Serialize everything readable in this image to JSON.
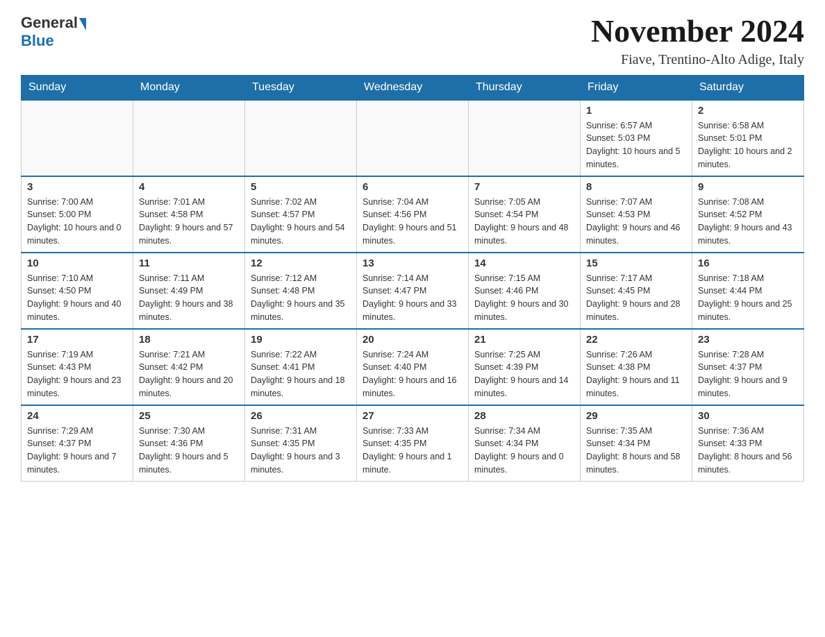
{
  "logo": {
    "general": "General",
    "blue": "Blue"
  },
  "title": "November 2024",
  "location": "Fiave, Trentino-Alto Adige, Italy",
  "days_of_week": [
    "Sunday",
    "Monday",
    "Tuesday",
    "Wednesday",
    "Thursday",
    "Friday",
    "Saturday"
  ],
  "weeks": [
    [
      {
        "day": "",
        "info": ""
      },
      {
        "day": "",
        "info": ""
      },
      {
        "day": "",
        "info": ""
      },
      {
        "day": "",
        "info": ""
      },
      {
        "day": "",
        "info": ""
      },
      {
        "day": "1",
        "info": "Sunrise: 6:57 AM\nSunset: 5:03 PM\nDaylight: 10 hours and 5 minutes."
      },
      {
        "day": "2",
        "info": "Sunrise: 6:58 AM\nSunset: 5:01 PM\nDaylight: 10 hours and 2 minutes."
      }
    ],
    [
      {
        "day": "3",
        "info": "Sunrise: 7:00 AM\nSunset: 5:00 PM\nDaylight: 10 hours and 0 minutes."
      },
      {
        "day": "4",
        "info": "Sunrise: 7:01 AM\nSunset: 4:58 PM\nDaylight: 9 hours and 57 minutes."
      },
      {
        "day": "5",
        "info": "Sunrise: 7:02 AM\nSunset: 4:57 PM\nDaylight: 9 hours and 54 minutes."
      },
      {
        "day": "6",
        "info": "Sunrise: 7:04 AM\nSunset: 4:56 PM\nDaylight: 9 hours and 51 minutes."
      },
      {
        "day": "7",
        "info": "Sunrise: 7:05 AM\nSunset: 4:54 PM\nDaylight: 9 hours and 48 minutes."
      },
      {
        "day": "8",
        "info": "Sunrise: 7:07 AM\nSunset: 4:53 PM\nDaylight: 9 hours and 46 minutes."
      },
      {
        "day": "9",
        "info": "Sunrise: 7:08 AM\nSunset: 4:52 PM\nDaylight: 9 hours and 43 minutes."
      }
    ],
    [
      {
        "day": "10",
        "info": "Sunrise: 7:10 AM\nSunset: 4:50 PM\nDaylight: 9 hours and 40 minutes."
      },
      {
        "day": "11",
        "info": "Sunrise: 7:11 AM\nSunset: 4:49 PM\nDaylight: 9 hours and 38 minutes."
      },
      {
        "day": "12",
        "info": "Sunrise: 7:12 AM\nSunset: 4:48 PM\nDaylight: 9 hours and 35 minutes."
      },
      {
        "day": "13",
        "info": "Sunrise: 7:14 AM\nSunset: 4:47 PM\nDaylight: 9 hours and 33 minutes."
      },
      {
        "day": "14",
        "info": "Sunrise: 7:15 AM\nSunset: 4:46 PM\nDaylight: 9 hours and 30 minutes."
      },
      {
        "day": "15",
        "info": "Sunrise: 7:17 AM\nSunset: 4:45 PM\nDaylight: 9 hours and 28 minutes."
      },
      {
        "day": "16",
        "info": "Sunrise: 7:18 AM\nSunset: 4:44 PM\nDaylight: 9 hours and 25 minutes."
      }
    ],
    [
      {
        "day": "17",
        "info": "Sunrise: 7:19 AM\nSunset: 4:43 PM\nDaylight: 9 hours and 23 minutes."
      },
      {
        "day": "18",
        "info": "Sunrise: 7:21 AM\nSunset: 4:42 PM\nDaylight: 9 hours and 20 minutes."
      },
      {
        "day": "19",
        "info": "Sunrise: 7:22 AM\nSunset: 4:41 PM\nDaylight: 9 hours and 18 minutes."
      },
      {
        "day": "20",
        "info": "Sunrise: 7:24 AM\nSunset: 4:40 PM\nDaylight: 9 hours and 16 minutes."
      },
      {
        "day": "21",
        "info": "Sunrise: 7:25 AM\nSunset: 4:39 PM\nDaylight: 9 hours and 14 minutes."
      },
      {
        "day": "22",
        "info": "Sunrise: 7:26 AM\nSunset: 4:38 PM\nDaylight: 9 hours and 11 minutes."
      },
      {
        "day": "23",
        "info": "Sunrise: 7:28 AM\nSunset: 4:37 PM\nDaylight: 9 hours and 9 minutes."
      }
    ],
    [
      {
        "day": "24",
        "info": "Sunrise: 7:29 AM\nSunset: 4:37 PM\nDaylight: 9 hours and 7 minutes."
      },
      {
        "day": "25",
        "info": "Sunrise: 7:30 AM\nSunset: 4:36 PM\nDaylight: 9 hours and 5 minutes."
      },
      {
        "day": "26",
        "info": "Sunrise: 7:31 AM\nSunset: 4:35 PM\nDaylight: 9 hours and 3 minutes."
      },
      {
        "day": "27",
        "info": "Sunrise: 7:33 AM\nSunset: 4:35 PM\nDaylight: 9 hours and 1 minute."
      },
      {
        "day": "28",
        "info": "Sunrise: 7:34 AM\nSunset: 4:34 PM\nDaylight: 9 hours and 0 minutes."
      },
      {
        "day": "29",
        "info": "Sunrise: 7:35 AM\nSunset: 4:34 PM\nDaylight: 8 hours and 58 minutes."
      },
      {
        "day": "30",
        "info": "Sunrise: 7:36 AM\nSunset: 4:33 PM\nDaylight: 8 hours and 56 minutes."
      }
    ]
  ]
}
